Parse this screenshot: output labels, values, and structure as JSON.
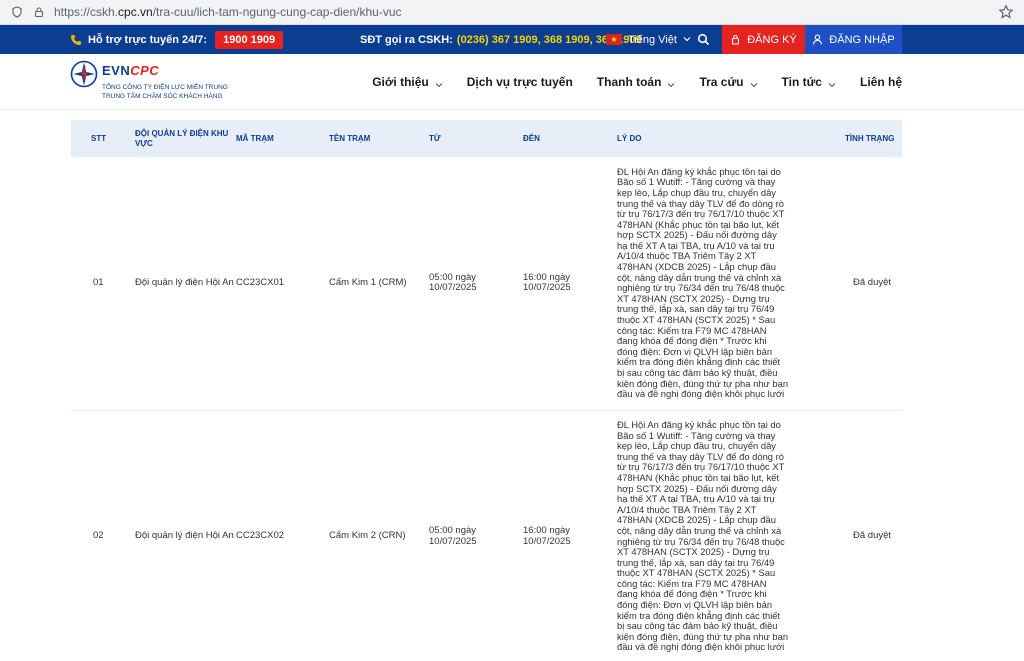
{
  "browser": {
    "url_prefix": "https://cskh.",
    "url_host": "cpc.vn",
    "url_path": "/tra-cuu/lich-tam-ngung-cung-cap-dien/khu-vuc"
  },
  "topbar": {
    "hotline_label": "Hỗ trợ trực tuyến 24/7:",
    "hotline_number": "1900 1909",
    "cskh_label": "SĐT gọi ra CSKH:",
    "cskh_numbers": "(0236) 367 1909, 368 1909, 369 1909",
    "language": "Tiếng Việt",
    "register": "ĐĂNG KÝ",
    "login": "ĐĂNG NHẬP",
    "colors": {
      "bar": "#0b3d91",
      "accent_red": "#e52421",
      "login_blue": "#1f4fc4",
      "number_yellow": "#f5d300"
    }
  },
  "logo": {
    "brand_evn": "EVN",
    "brand_cpc": "CPC",
    "line1": "TỔNG CÔNG TY ĐIỆN LỰC MIỀN TRUNG",
    "line2": "TRUNG TÂM CHĂM SÓC KHÁCH HÀNG"
  },
  "nav": {
    "items": [
      {
        "label": "Giới thiệu",
        "has_dropdown": true
      },
      {
        "label": "Dịch vụ trực tuyến",
        "has_dropdown": false
      },
      {
        "label": "Thanh toán",
        "has_dropdown": true
      },
      {
        "label": "Tra cứu",
        "has_dropdown": true
      },
      {
        "label": "Tin tức",
        "has_dropdown": true
      },
      {
        "label": "Liên hệ",
        "has_dropdown": false
      }
    ]
  },
  "table": {
    "headers": {
      "stt": "STT",
      "doi": "ĐỘI QUẢN LÝ ĐIỆN KHU VỰC",
      "ma": "MÃ TRẠM",
      "ten": "TÊN TRẠM",
      "tu": "TỪ",
      "den": "ĐẾN",
      "ly": "LÝ DO",
      "tt": "TÌNH TRẠNG"
    },
    "rows": [
      {
        "stt": "01",
        "doi": "Đội quản lý điện Hội An",
        "ma": "CC23CX01",
        "ten": "Cẩm Kim 1 (CRM)",
        "tu": "05:00 ngày 10/07/2025",
        "den": "16:00 ngày 10/07/2025",
        "ly": "ĐL Hội An đăng ký khắc phục tồn tại do Bão số 1 Wutiff: - Tăng cường và thay kẹp lèo, Lắp chụp đầu trụ, chuyển dây trung thế và thay dây TLV để đo dòng rò từ trụ 76/17/3 đến trụ 76/17/10 thuộc XT 478HAN (Khắc phục tồn tại bão lụt, kết hợp SCTX 2025) - Đấu nối đường dây hạ thế XT A tại TBA, trụ A/10 và tại trụ A/10/4 thuộc TBA Triêm Tây 2 XT 478HAN (XDCB 2025) - Lắp chụp đầu cột, nâng dây dẫn trung thế và chỉnh xà nghiêng từ trụ 76/34 đến trụ 76/48 thuộc XT 478HAN (SCTX 2025) - Dựng trụ trung thế, lắp xà, san dây tại trụ 76/49 thuộc XT 478HAN (SCTX 2025) * Sau công tác: Kiểm tra F79 MC 478HAN đang khóa để đóng điện * Trước khi đóng điện: Đơn vị QLVH lập biên bản kiểm tra đóng điện khẳng định các thiết bị sau công tác đảm bảo kỹ thuật, điều kiện đóng điện, đúng thứ tự pha như ban đầu và đề nghị đóng điện khôi phục lưới",
        "tt": "Đã duyệt"
      },
      {
        "stt": "02",
        "doi": "Đội quản lý điện Hội An",
        "ma": "CC23CX02",
        "ten": "Cẩm Kim 2 (CRN)",
        "tu": "05:00 ngày 10/07/2025",
        "den": "16:00 ngày 10/07/2025",
        "ly": "ĐL Hội An đăng ký khắc phục tồn tại do Bão số 1 Wutiff: - Tăng cường và thay kẹp lèo, Lắp chụp đầu trụ, chuyển dây trung thế và thay dây TLV để đo dòng rò từ trụ 76/17/3 đến trụ 76/17/10 thuộc XT 478HAN (Khắc phục tồn tại bão lụt, kết hợp SCTX 2025) - Đấu nối đường dây hạ thế XT A tại TBA, trụ A/10 và tại trụ A/10/4 thuộc TBA Triêm Tây 2 XT 478HAN (XDCB 2025) - Lắp chụp đầu cột, nâng dây dẫn trung thế và chỉnh xà nghiêng từ trụ 76/34 đến trụ 76/48 thuộc XT 478HAN (SCTX 2025) - Dựng trụ trung thế, lắp xà, san dây tại trụ 76/49 thuộc XT 478HAN (SCTX 2025) * Sau công tác: Kiểm tra F79 MC 478HAN đang khóa để đóng điện * Trước khi đóng điện: Đơn vị QLVH lập biên bản kiểm tra đóng điện khẳng định các thiết bị sau công tác đảm bảo kỹ thuật, điều kiện đóng điện, đúng thứ tự pha như ban đầu và đề nghị đóng điện khôi phục lưới",
        "tt": "Đã duyệt"
      }
    ]
  }
}
